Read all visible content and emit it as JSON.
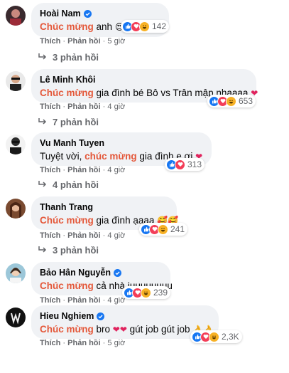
{
  "labels": {
    "like": "Thích",
    "reply": "Phản hồi",
    "sep": "·"
  },
  "comments": [
    {
      "name": "Hoài Nam",
      "verified": true,
      "pre": "",
      "highlight": "Chúc mừng",
      "post": " anh",
      "emoji": "😍",
      "count": "142",
      "time": "5 giờ",
      "replies": "3 phản hồi"
    },
    {
      "name": "Lê Minh Khôi",
      "verified": false,
      "pre": "",
      "highlight": "Chúc mừng",
      "post": " gia đình bé Bô vs Trân mập nhaaaa",
      "emoji": "❤",
      "count": "653",
      "time": "4 giờ",
      "replies": "7 phản hồi"
    },
    {
      "name": "Vu Manh Tuyen",
      "verified": false,
      "pre": "Tuyệt vời, ",
      "highlight": "chúc mừng",
      "post": " gia đình e ơi",
      "emoji": "❤",
      "count": "313",
      "time": "4 giờ",
      "replies": "4 phản hồi"
    },
    {
      "name": "Thanh Trang",
      "verified": false,
      "pre": "",
      "highlight": "Chúc mừng",
      "post": " gia đình ạaaa",
      "emoji": "🥰🥰",
      "count": "241",
      "time": "4 giờ",
      "replies": "3 phản hồi"
    },
    {
      "name": "Bảo Hân Nguyễn",
      "verified": true,
      "pre": "",
      "highlight": "Chúc mừng",
      "post": " cả nhà iuuuuuuuu",
      "emoji": "",
      "count": "239",
      "time": "4 giờ",
      "replies": ""
    },
    {
      "name": "Hieu Nghiem",
      "verified": true,
      "pre": "",
      "highlight": "Chúc mừng",
      "post": " bro ",
      "emoji": "❤❤",
      "post2": " gút job gút job ",
      "emoji2": "👌👌",
      "count": "2,3K",
      "time": "5 giờ",
      "replies": ""
    }
  ],
  "colors": {
    "accent": "#e4583a",
    "like": "#1877f2",
    "love": "#f33e58",
    "haha": "#f7b125",
    "meta": "#65676b",
    "bubble": "#f0f2f5"
  },
  "icons": [
    "verified-badge-icon",
    "like-reaction-icon",
    "love-reaction-icon",
    "haha-reaction-icon",
    "reply-arrow-icon"
  ]
}
